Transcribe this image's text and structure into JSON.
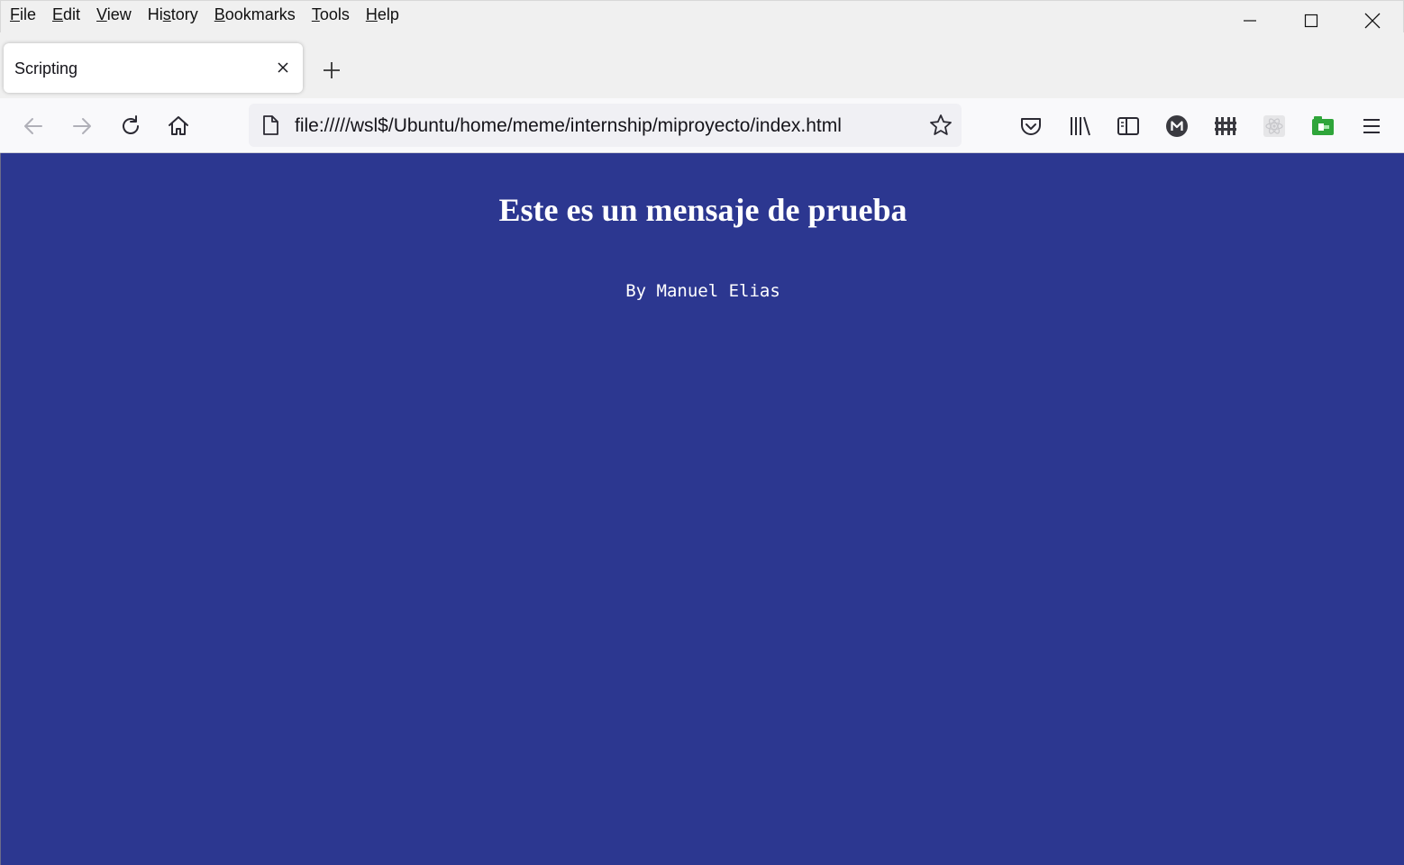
{
  "window": {
    "menu": [
      {
        "underline": "F",
        "rest": "ile"
      },
      {
        "underline": "E",
        "rest": "dit"
      },
      {
        "underline": "V",
        "rest": "iew"
      },
      {
        "underline": "H",
        "rest": "istory",
        "pre": "Hi",
        "u2": "s",
        "post": "tory"
      },
      {
        "underline": "B",
        "rest": "ookmarks"
      },
      {
        "underline": "T",
        "rest": "ools"
      },
      {
        "underline": "H",
        "rest": "elp"
      }
    ]
  },
  "tab": {
    "title": "Scripting"
  },
  "urlbar": {
    "url": "file://///wsl$/Ubuntu/home/meme/internship/miproyecto/index.html"
  },
  "page": {
    "heading": "Este es un mensaje de prueba",
    "author": "By Manuel Elias",
    "background": "#2c3790"
  },
  "icons": {
    "back": "back-arrow-icon",
    "forward": "forward-arrow-icon",
    "reload": "reload-icon",
    "home": "home-icon",
    "pocket": "pocket-icon",
    "library": "library-icon",
    "sidebar": "sidebar-icon",
    "account": "account-m-icon",
    "extension1": "fence-extension-icon",
    "extension2": "react-extension-icon",
    "extension3": "green-extension-icon",
    "menu": "hamburger-menu-icon"
  }
}
